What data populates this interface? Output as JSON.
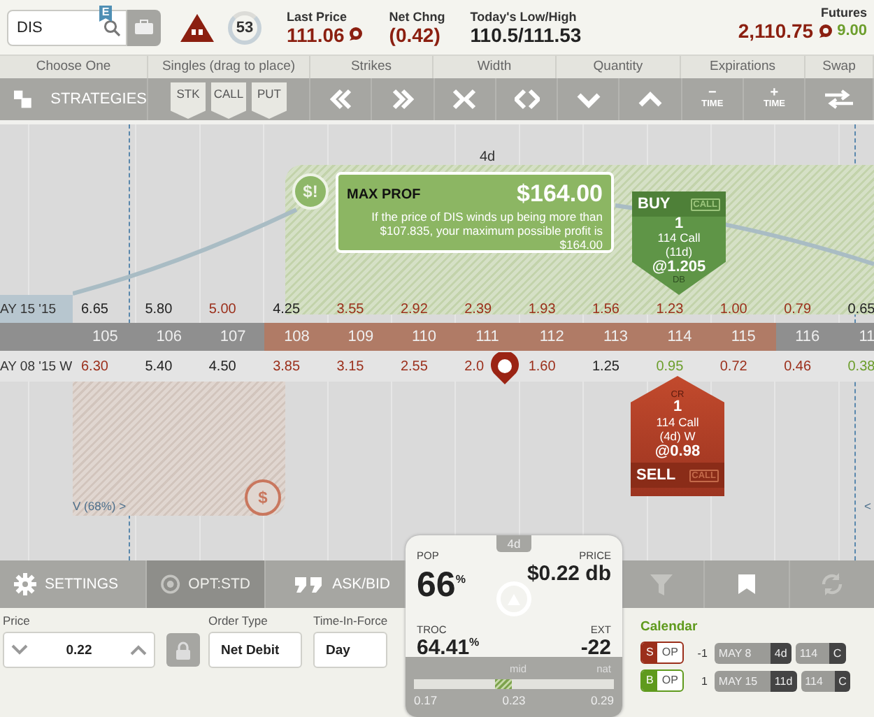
{
  "search": {
    "value": "DIS",
    "badge": "E"
  },
  "alert_count": "53",
  "quotes": [
    {
      "label": "Last Price",
      "value": "111.06",
      "color": "#8b1f10",
      "chat": true
    },
    {
      "label": "Net Chng",
      "value": "(0.42)",
      "color": "#8b1f10",
      "chat": false
    },
    {
      "label": "Today's Low/High",
      "value": "110.5/111.53",
      "color": "#222222",
      "chat": false
    }
  ],
  "futures": {
    "label": "Futures",
    "value": "2,110.75",
    "change": "9.00"
  },
  "toolbar": {
    "groups": [
      "Choose One",
      "Singles (drag to place)",
      "Strikes",
      "Width",
      "Quantity",
      "Expirations",
      "Swap"
    ],
    "strategies": "STRATEGIES",
    "singles": [
      "STK",
      "CALL",
      "PUT"
    ],
    "time_buttons": [
      {
        "sign": "−",
        "label": "TIME"
      },
      {
        "sign": "+",
        "label": "TIME"
      }
    ]
  },
  "chart": {
    "expiry": "4d",
    "max_profit": {
      "icon": "$!",
      "title": "MAX PROF",
      "amount": "$164.00",
      "text": "If the price of DIS winds up being more than $107.835, your maximum possible profit is $164.00"
    },
    "loss_icon": "$",
    "legs": [
      {
        "kind": "buy",
        "action": "BUY",
        "type": "CALL",
        "qty": "1",
        "desc": "114 Call",
        "expiry": "(11d)",
        "price": "@1.205",
        "flag": "DB"
      },
      {
        "kind": "sell",
        "action": "SELL",
        "type": "CALL",
        "qty": "1",
        "desc": "114 Call",
        "expiry": "(4d) W",
        "price": "@0.98",
        "flag": "CR"
      }
    ],
    "rows": [
      {
        "label": "AY 15 '15",
        "highlight": true,
        "cells": [
          {
            "v": "6.65",
            "color": "#222222"
          },
          {
            "v": "5.80",
            "color": "#222222"
          },
          {
            "v": "5.00",
            "color": "#9b2f1b"
          },
          {
            "v": "4.25",
            "color": "#222222"
          },
          {
            "v": "3.55",
            "color": "#9b2f1b"
          },
          {
            "v": "2.92",
            "color": "#9b2f1b"
          },
          {
            "v": "2.39",
            "color": "#9b2f1b"
          },
          {
            "v": "1.93",
            "color": "#9b2f1b"
          },
          {
            "v": "1.56",
            "color": "#9b2f1b"
          },
          {
            "v": "1.23",
            "color": "#9b2f1b"
          },
          {
            "v": "1.00",
            "color": "#9b2f1b"
          },
          {
            "v": "0.79",
            "color": "#9b2f1b"
          },
          {
            "v": "0.65",
            "color": "#222222"
          }
        ]
      },
      {
        "label": "AY 08 '15 W",
        "highlight": false,
        "cells": [
          {
            "v": "6.30",
            "color": "#9b2f1b"
          },
          {
            "v": "5.40",
            "color": "#222222"
          },
          {
            "v": "4.50",
            "color": "#222222"
          },
          {
            "v": "3.85",
            "color": "#9b2f1b"
          },
          {
            "v": "3.15",
            "color": "#9b2f1b"
          },
          {
            "v": "2.55",
            "color": "#9b2f1b"
          },
          {
            "v": "2.0",
            "color": "#9b2f1b"
          },
          {
            "v": "1.60",
            "color": "#9b2f1b"
          },
          {
            "v": "1.25",
            "color": "#222222"
          },
          {
            "v": "0.95",
            "color": "#6c9e2c"
          },
          {
            "v": "0.72",
            "color": "#9b2f1b"
          },
          {
            "v": "0.46",
            "color": "#9b2f1b"
          },
          {
            "v": "0.38",
            "color": "#6c9e2c"
          }
        ]
      }
    ],
    "strikes": [
      {
        "v": "105",
        "in_range": false
      },
      {
        "v": "106",
        "in_range": false
      },
      {
        "v": "107",
        "in_range": false
      },
      {
        "v": "108",
        "in_range": true
      },
      {
        "v": "109",
        "in_range": true
      },
      {
        "v": "110",
        "in_range": true
      },
      {
        "v": "111",
        "in_range": true
      },
      {
        "v": "112",
        "in_range": true
      },
      {
        "v": "113",
        "in_range": true
      },
      {
        "v": "114",
        "in_range": true
      },
      {
        "v": "115",
        "in_range": true
      },
      {
        "v": "116",
        "in_range": false
      },
      {
        "v": "11",
        "in_range": false
      }
    ],
    "range_left": "V (68%) >",
    "range_right": "<"
  },
  "order": {
    "tabs": [
      {
        "label": "SETTINGS",
        "disabled": false
      },
      {
        "label": "OPT:STD",
        "disabled": true
      },
      {
        "label": "ASK/BID",
        "disabled": false
      }
    ],
    "tools": [
      {
        "selected": false
      },
      {
        "selected": true
      },
      {
        "selected": false
      }
    ],
    "price": {
      "label": "Price",
      "value": "0.22"
    },
    "order_type": {
      "label": "Order Type",
      "value": "Net Debit"
    },
    "tif": {
      "label": "Time-In-Force",
      "value": "Day"
    }
  },
  "summary": {
    "tab": "4d",
    "pop_label": "POP",
    "pop": "66",
    "pop_unit": "%",
    "price_label": "PRICE",
    "price": "$0.22 db",
    "troc_label": "TROC",
    "troc": "64.41",
    "troc_unit": "%",
    "ext_label": "EXT",
    "ext": "-22",
    "mid_label": "mid",
    "nat_label": "nat",
    "level": 0.45,
    "ticks": [
      "0.17",
      "0.23",
      "0.29"
    ]
  },
  "calendar": {
    "title": "Calendar",
    "legs": [
      {
        "kind": "sell",
        "side_label": "S",
        "type": "OP",
        "qty": "-1",
        "date": "MAY 8",
        "days": "4d",
        "strike": "114",
        "right": "C"
      },
      {
        "kind": "buy",
        "side_label": "B",
        "type": "OP",
        "qty": "1",
        "date": "MAY 15",
        "days": "11d",
        "strike": "114",
        "right": "C"
      }
    ]
  }
}
